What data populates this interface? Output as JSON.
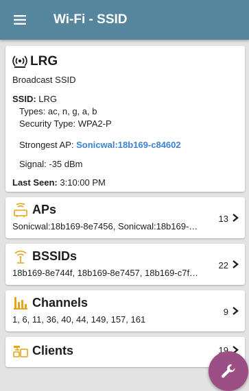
{
  "appbar": {
    "title": "Wi-Fi - SSID"
  },
  "detail": {
    "ssid_name": "LRG",
    "subtitle": "Broadcast SSID",
    "ssid_label": "SSID:",
    "ssid_value": "LRG",
    "types_label": "Types:",
    "types_value": "ac, n, g, a, b",
    "security_label": "Security Type:",
    "security_value": "WPA2-P",
    "strongest_label": "Strongest AP:",
    "strongest_value": "Sonicwal:18b169-c84602",
    "signal_label": "Signal:",
    "signal_value": "-35 dBm",
    "last_seen_label": "Last Seen:",
    "last_seen_value": "3:10:00 PM"
  },
  "rows": [
    {
      "title": "APs",
      "subtitle": "Sonicwal:18b169-8e7456, Sonicwal:18b169-…",
      "count": "13",
      "icon": "ap-icon"
    },
    {
      "title": "BSSIDs",
      "subtitle": "18b169-8e744f, 18b169-8e7457, 18b169-c7f…",
      "count": "22",
      "icon": "bssid-icon"
    },
    {
      "title": "Channels",
      "subtitle": "1, 6, 11, 36, 40, 44, 149, 157, 161",
      "count": "9",
      "icon": "channels-icon"
    },
    {
      "title": "Clients",
      "subtitle": "",
      "count": "19",
      "icon": "clients-icon"
    }
  ],
  "colors": {
    "appbar": "#55869e",
    "accent_icon": "#e8a317",
    "link": "#3b82d4",
    "fab": "#9b4f84"
  }
}
